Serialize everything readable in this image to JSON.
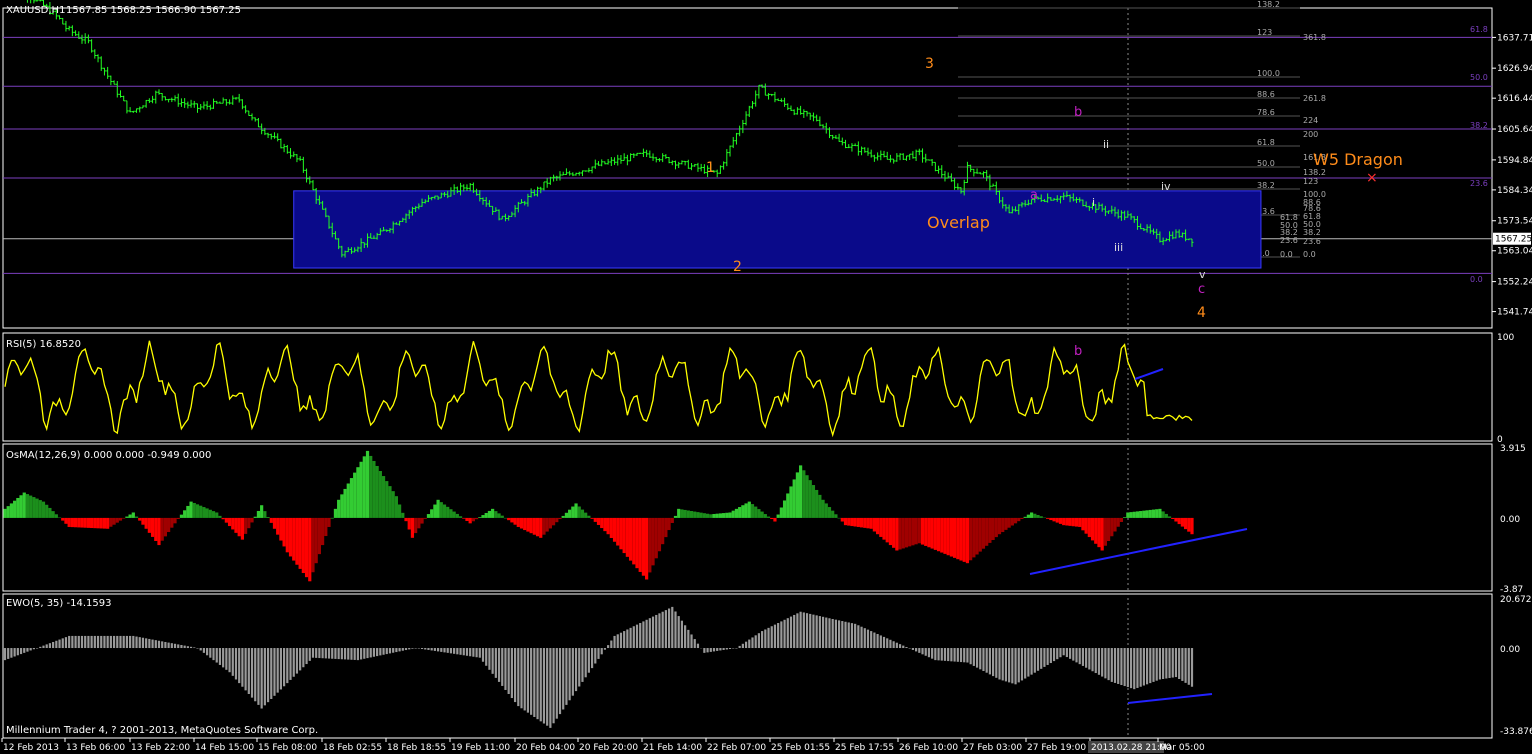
{
  "window": {
    "symbol_title": "XAUUSD,H1",
    "ohlc_readout": "1567.85 1568.25 1566.90 1567.25",
    "copyright": "Millennium Trader 4, ? 2001-2013, MetaQuotes Software Corp."
  },
  "colors": {
    "background": "#000000",
    "price": "#22ff22",
    "rsi": "#ffff00",
    "osma_up": "#33cc33",
    "osma_dark": "#1c8f1c",
    "osma_down": "#ff0000",
    "osma_down_dark": "#a00000",
    "ewo": "#9a9a9a",
    "fib_levels": "#7b3fbf",
    "wave_primary": "#ff8c1a",
    "wave_secondary": "#c020c0",
    "wave_minor": "#dddddd",
    "overlap_box": "#0a0a8a",
    "divergence_line": "#2222ff",
    "axis_text": "#ffffff"
  },
  "chart_data": [
    {
      "type": "line",
      "name": "price",
      "title": "XAUUSD,H1",
      "ylim": [
        1536,
        1648
      ],
      "x_ticks": [
        "12 Feb 2013",
        "13 Feb 06:00",
        "13 Feb 22:00",
        "14 Feb 15:00",
        "15 Feb 08:00",
        "18 Feb 02:55",
        "18 Feb 18:55",
        "19 Feb 11:00",
        "20 Feb 04:00",
        "20 Feb 20:00",
        "21 Feb 14:00",
        "22 Feb 07:00",
        "25 Feb 01:55",
        "25 Feb 17:55",
        "26 Feb 10:00",
        "27 Feb 03:00",
        "27 Feb 19:00",
        "2013.02.28 21:00",
        "Mar 05:00"
      ],
      "y_ticks": [
        "1637.71",
        "1626.94",
        "1616.44",
        "1605.64",
        "1594.84",
        "1584.34",
        "1573.54",
        "1563.04",
        "1552.24",
        "1541.74"
      ],
      "current_price": "1567.25",
      "anchor_times": [
        0,
        8,
        13,
        17,
        19,
        23,
        26,
        30,
        39,
        47,
        60,
        73,
        77,
        83,
        92,
        105,
        117,
        130,
        145,
        155,
        170,
        185,
        200,
        222,
        235,
        246,
        253,
        260,
        275,
        285,
        298,
        300,
        305,
        313,
        320,
        330,
        341,
        350,
        360,
        365,
        370
      ],
      "anchor_prices": [
        1655,
        1652,
        1648,
        1644,
        1641,
        1638,
        1636,
        1628,
        1611,
        1618,
        1613,
        1616,
        1609,
        1603,
        1594,
        1562,
        1569,
        1580,
        1586,
        1574,
        1588,
        1593,
        1597,
        1590,
        1620,
        1612,
        1609,
        1601,
        1595,
        1597,
        1584,
        1592,
        1590,
        1576,
        1581,
        1582,
        1578,
        1575,
        1567,
        1569,
        1567
      ],
      "overlays": {
        "horizontal_levels": [
          "1637.71",
          "1620.6",
          "1605.64",
          "1588.5",
          "1567.25",
          "1555.1"
        ],
        "fib_labels_left": [
          "138.2",
          "123",
          "100.0",
          "88.6",
          "78.6",
          "61.8",
          "50.0",
          "38.2",
          "23.6",
          "0.0"
        ],
        "fib_labels_right": [
          "361.8",
          "261.8",
          "224",
          "200",
          "161.8",
          "138.2",
          "123",
          "100.0",
          "88.6",
          "78.6",
          "61.8",
          "50.0",
          "38.2",
          "23.6",
          "0.0"
        ],
        "retracement_labels": [
          "61.8",
          "50.0",
          "38.2",
          "23.6",
          "0.0"
        ],
        "overlap_zone": {
          "label": "Overlap",
          "from_time": 90,
          "to_time": 365,
          "top_price": 1584,
          "bottom_price": 1557
        },
        "wave_labels": {
          "primary": [
            "1",
            "2",
            "3",
            "4"
          ],
          "secondary": [
            "a",
            "b",
            "c"
          ],
          "minor": [
            "i",
            "ii",
            "iii",
            "iv",
            "v"
          ]
        },
        "projection_label": "W5 Dragon",
        "projection_marker": "×"
      }
    },
    {
      "type": "line",
      "name": "RSI(5) 16.8520",
      "indicator_label": "RSI(5) 16.8520",
      "ylim": [
        0,
        100
      ],
      "y_ticks": [
        "100",
        "0"
      ],
      "wave_label": "b"
    },
    {
      "type": "bar",
      "name": "OsMA(12,26,9) 0.000 0.000 -0.949 0.000",
      "indicator_label": "OsMA(12,26,9) 0.000 0.000 -0.949 0.000",
      "ylim": [
        -3.87,
        3.915
      ],
      "y_ticks": [
        "3.915",
        "0.00",
        "-3.87"
      ],
      "anchor_bars": [
        0,
        6,
        12,
        20,
        32,
        40,
        48,
        58,
        66,
        74,
        80,
        88,
        95,
        104,
        113,
        122,
        127,
        135,
        145,
        152,
        160,
        167,
        178,
        188,
        200,
        210,
        220,
        226,
        232,
        240,
        248,
        255,
        262,
        270,
        278,
        285,
        300,
        310,
        320,
        330,
        335,
        342,
        350,
        360,
        365,
        370
      ],
      "anchor_values": [
        0.5,
        1.4,
        0.9,
        -0.5,
        -0.6,
        0.3,
        -1.5,
        0.9,
        0.3,
        -1.2,
        0.7,
        -1.9,
        -3.5,
        1.0,
        3.7,
        1.2,
        -1.1,
        1.0,
        -0.3,
        0.5,
        -0.5,
        -1.1,
        0.8,
        -0.9,
        -3.4,
        0.5,
        0.2,
        0.3,
        0.9,
        -0.2,
        2.9,
        1.0,
        -0.4,
        -0.6,
        -1.8,
        -1.4,
        -2.5,
        -0.9,
        0.3,
        -0.4,
        -0.5,
        -1.8,
        0.3,
        0.5,
        -0.2,
        -0.9
      ]
    },
    {
      "type": "bar",
      "name": "EWO(5, 35) -14.1593",
      "indicator_label": "EWO(5, 35) -14.1593",
      "ylim": [
        -33.8763,
        20.6721
      ],
      "y_ticks": [
        "20.6721",
        "0.00",
        "-33.8763"
      ],
      "anchor_bars": [
        0,
        10,
        20,
        40,
        60,
        70,
        80,
        96,
        110,
        128,
        148,
        160,
        170,
        180,
        190,
        208,
        218,
        228,
        236,
        248,
        258,
        265,
        275,
        290,
        300,
        310,
        315,
        330,
        345,
        352,
        360,
        365,
        370
      ],
      "anchor_values": [
        -5,
        0,
        5,
        5,
        0,
        -10,
        -25,
        -4,
        -5,
        0,
        -4,
        -24,
        -33,
        -14,
        5,
        17,
        -2,
        0,
        7,
        15,
        12,
        10,
        4,
        -5,
        -6,
        -13,
        -15,
        -3,
        -14,
        -17,
        -13,
        -12,
        -16
      ]
    }
  ]
}
